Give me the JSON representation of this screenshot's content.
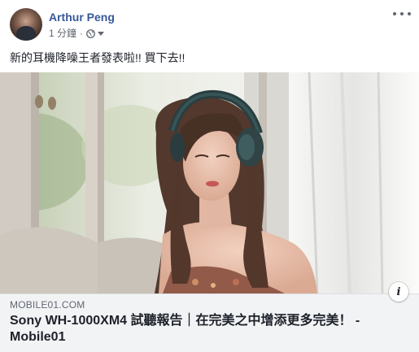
{
  "post": {
    "author": "Arthur Peng",
    "timestamp": "1 分鐘",
    "separator": "·",
    "privacy_icon": "globe-icon",
    "text": "新的耳機降噪王者發表啦!! 買下去!!"
  },
  "link_preview": {
    "domain": "MOBILE01.COM",
    "title": "Sony WH-1000XM4 試聽報告｜在完美之中增添更多完美！ - Mobile01",
    "info_label": "i"
  },
  "colors": {
    "author": "#365899",
    "link_box_bg": "#f2f3f5",
    "text": "#1d2129",
    "secondary": "#616770"
  }
}
